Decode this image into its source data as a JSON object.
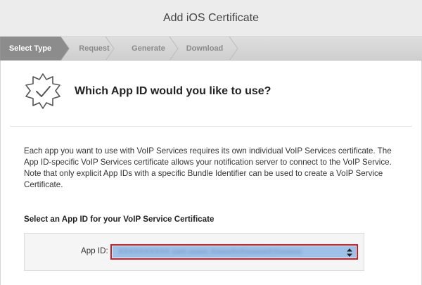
{
  "window": {
    "title": "Add iOS Certificate"
  },
  "steps": [
    {
      "label": "Select Type",
      "active": true
    },
    {
      "label": "Request",
      "active": false
    },
    {
      "label": "Generate",
      "active": false
    },
    {
      "label": "Download",
      "active": false
    }
  ],
  "main": {
    "heading": "Which App ID would you like to use?",
    "description": "Each app you want to use with VoIP Services requires its own individual VoIP Services certificate. The App ID-specific VoIP Services certificate allows your notification server to connect to the VoIP Service. Note that only explicit App IDs with a specific Bundle Identifier can be used to create a VoIP Service Certificate.",
    "section_label": "Select an App ID for your VoIP Service Certificate",
    "app_id": {
      "label": "App ID:",
      "selected_value": "XXXXXXXXXX com.xxxxx.XxxxxXxXxxxxxxXXxxxxxx"
    }
  },
  "colors": {
    "active_step": "#8c8c8c",
    "highlight_border": "#d11a2a",
    "select_fill": "#9fc1e8"
  },
  "icons": {
    "badge": "certificate-badge-checkmark-icon",
    "select_arrows": "updown-arrows-icon"
  }
}
